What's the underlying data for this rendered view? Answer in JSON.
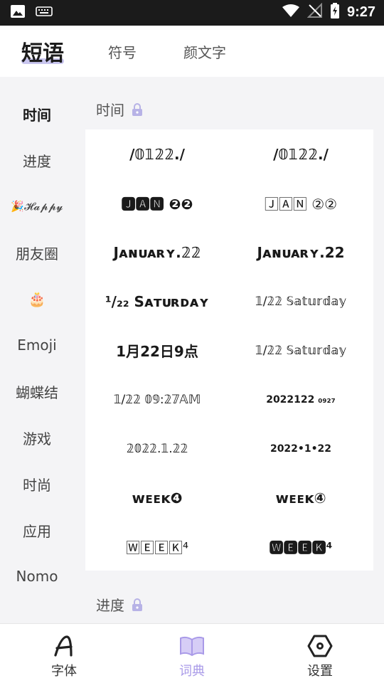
{
  "status_bar": {
    "time": "9:27",
    "left_icons": [
      "image-icon",
      "keyboard-icon"
    ],
    "right_icons": [
      "wifi-icon",
      "no-signal-icon",
      "battery-charging-icon"
    ]
  },
  "top_tabs": [
    {
      "label": "短语",
      "active": true
    },
    {
      "label": "符号",
      "active": false
    },
    {
      "label": "颜文字",
      "active": false
    }
  ],
  "sidebar": {
    "items": [
      {
        "label": "时间",
        "active": true
      },
      {
        "label": "进度"
      },
      {
        "label": "🎉𝓗𝓪𝓹𝓹𝔂"
      },
      {
        "label": "朋友圈"
      },
      {
        "label": "🎂"
      },
      {
        "label": "Emoji"
      },
      {
        "label": "蝴蝶结"
      },
      {
        "label": "游戏"
      },
      {
        "label": "时尚"
      },
      {
        "label": "应用"
      },
      {
        "label": "Nomo"
      }
    ]
  },
  "sections": {
    "time": {
      "title": "时间",
      "locked": true
    },
    "progress": {
      "title": "进度",
      "locked": true
    }
  },
  "phrases": [
    "/𝟘𝟙𝟚𝟚./",
    "/𝟘𝟙𝟚𝟚./",
    "🅹🅰🅽 ❷❷",
    "🄹🄰🄽 ②②",
    "Jᴀɴᴜᴀʀʏ.𝟚𝟚",
    "Jᴀɴᴜᴀʀʏ.22",
    "¹/₂₂ Sᴀᴛᴜʀᴅᴀʏ",
    "𝟙/𝟚𝟚 𝕊𝕒𝕥𝕦𝕣𝕕𝕒𝕪",
    "1月22日9点",
    "𝟙/𝟚𝟚 𝕊𝕒𝕥𝕦𝕣𝕕𝕒𝕪",
    "𝟙/𝟚𝟚 𝟘𝟡:𝟚𝟟𝔸𝕄",
    "2022122 ₀₉₂₇",
    "𝟚𝟘𝟚𝟚.𝟙.𝟚𝟚",
    "2022•1•22",
    "ᴡᴇᴇᴋ❹",
    "ᴡᴇᴇᴋ④",
    "🅆🄴🄴🄺⁴",
    "🆆🅴🅴🅺⁴"
  ],
  "bottom_nav": [
    {
      "label": "字体",
      "icon": "font-a-icon",
      "active": false
    },
    {
      "label": "词典",
      "icon": "book-icon",
      "active": true
    },
    {
      "label": "设置",
      "icon": "hexagon-settings-icon",
      "active": false
    }
  ],
  "colors": {
    "accent": "#a99ae8",
    "accent_underline": "#c9c6ef",
    "status_bar": "#1b1b1b",
    "background": "#f4f4f6",
    "lock": "#b7b2e6"
  }
}
